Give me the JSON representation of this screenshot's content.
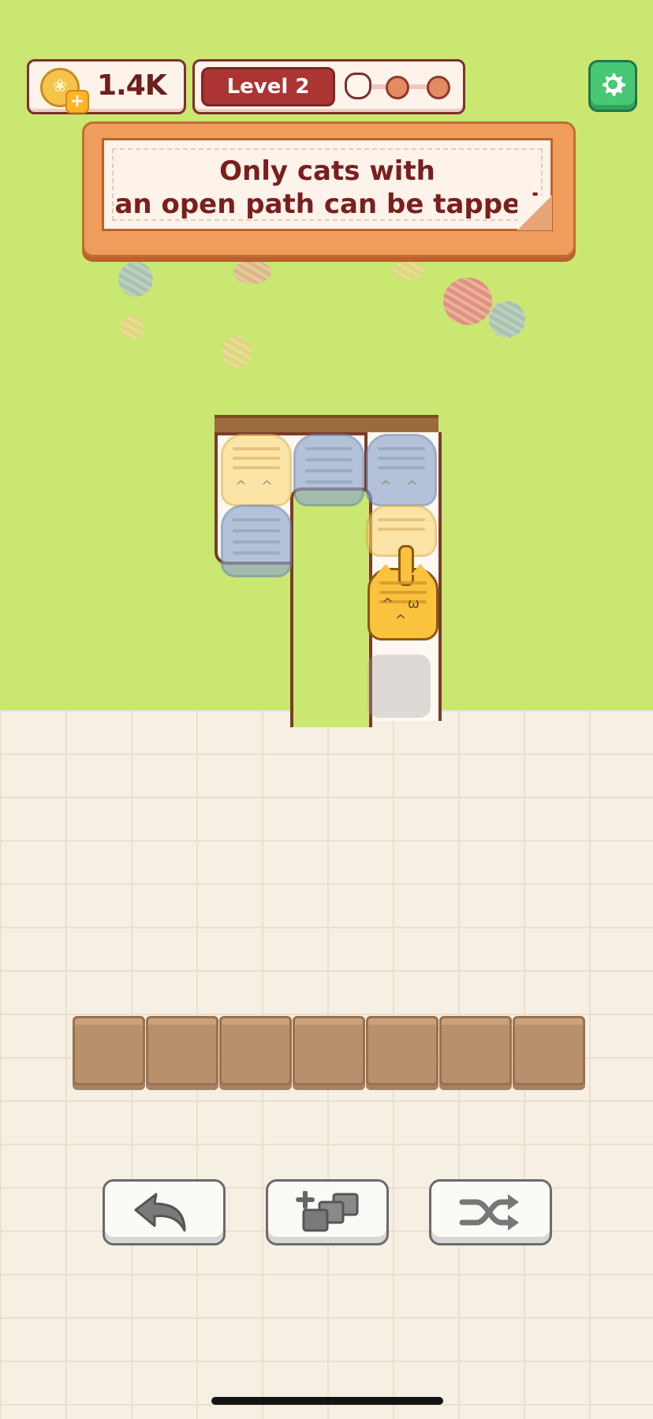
{
  "hud": {
    "coins": "1.4K",
    "level_label": "Level 2"
  },
  "hint": {
    "line1": "Only cats with",
    "line2": "an open path can be tapped"
  },
  "board": {
    "colors": {
      "blue": "#8da6cc",
      "yellow": "#fbd874",
      "orange": "#fbc23e"
    },
    "cats": [
      {
        "color": "yellow",
        "state": "blocked"
      },
      {
        "color": "blue",
        "state": "blocked"
      },
      {
        "color": "blue",
        "state": "blocked"
      },
      {
        "color": "blue",
        "state": "blocked"
      },
      {
        "color": "yellow",
        "state": "blocked"
      },
      {
        "color": "orange",
        "state": "tappable"
      }
    ]
  },
  "tray": {
    "slot_count": 7
  },
  "tools": [
    {
      "name": "undo",
      "icon": "undo-arrow-icon"
    },
    {
      "name": "add-slot",
      "icon": "add-tiles-icon"
    },
    {
      "name": "shuffle",
      "icon": "shuffle-icon"
    }
  ],
  "theme": {
    "accent": "#ac3432",
    "grass": "#c9e771",
    "settings": "#48c774"
  }
}
